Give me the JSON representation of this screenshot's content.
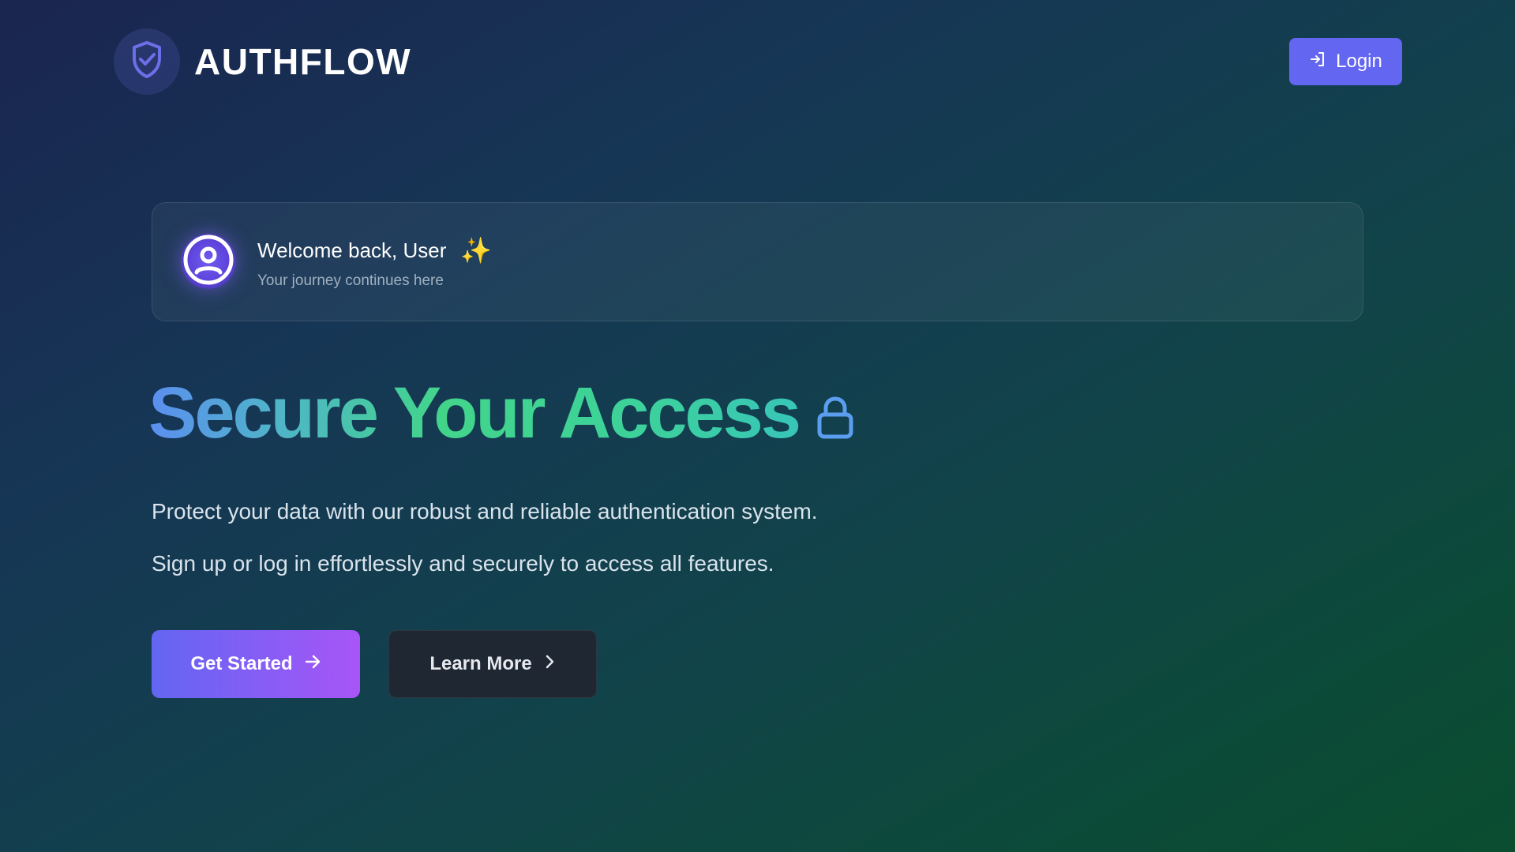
{
  "header": {
    "brand_name": "AUTHFLOW",
    "login_label": "Login"
  },
  "welcome": {
    "title": "Welcome back, User",
    "sparkle": "✨",
    "subtitle": "Your journey continues here"
  },
  "hero": {
    "title": "Secure Your Access",
    "description_1": "Protect your data with our robust and reliable authentication system.",
    "description_2": "Sign up or log in effortlessly and securely to access all features."
  },
  "actions": {
    "get_started_label": "Get Started",
    "learn_more_label": "Learn More"
  },
  "icons": {
    "brand": "shield-check-icon",
    "login": "sign-in-icon",
    "avatar": "user-circle-icon",
    "hero": "lock-icon",
    "get_started": "arrow-right-icon",
    "learn_more": "chevron-right-icon"
  },
  "colors": {
    "accent": "#6366f1",
    "accent_secondary": "#a855f7",
    "gradient_blue": "#5b8ef0",
    "gradient_green": "#42d58a",
    "lock_blue": "#5b9ef0",
    "sparkle": "#f6c343"
  }
}
